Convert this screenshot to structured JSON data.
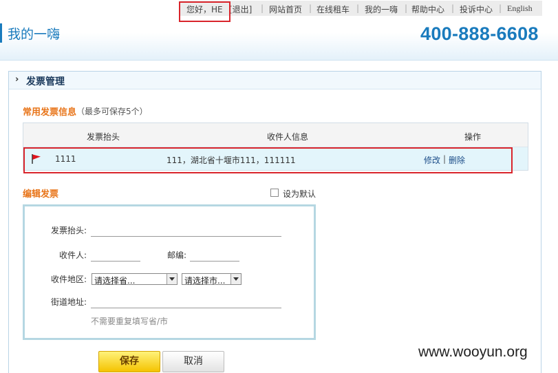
{
  "header": {
    "greeting": "您好，HE",
    "logout": "[退出]",
    "nav": [
      "网站首页",
      "在线租车",
      "我的一嗨",
      "帮助中心",
      "投诉中心",
      "English"
    ],
    "logo": "我的一嗨",
    "phone": "400-888-6608"
  },
  "panel": {
    "title": "发票管理"
  },
  "common_invoices": {
    "title": "常用发票信息",
    "note": "（最多可保存5个）",
    "columns": [
      "发票抬头",
      "收件人信息",
      "操作"
    ],
    "rows": [
      {
        "title": "1111",
        "recipient_info": "111，湖北省十堰市111，111111",
        "edit": "修改",
        "sep": "|",
        "delete": "删除"
      }
    ]
  },
  "edit_invoice": {
    "title": "编辑发票",
    "default_label": "设为默认",
    "fields": {
      "invoice_title_label": "发票抬头:",
      "recipient_label": "收件人:",
      "postcode_label": "邮编:",
      "region_label": "收件地区:",
      "province_placeholder": "请选择省...",
      "city_placeholder": "请选择市...",
      "street_label": "街道地址:",
      "street_hint": "不需要重复填写省/市"
    },
    "save": "保存",
    "cancel": "取消"
  },
  "watermark": "www.wooyun.org",
  "colors": {
    "accent_blue": "#1a7bbd",
    "section_orange": "#e8751a",
    "highlight_red": "#d9242b",
    "flag_red": "#e0141e"
  }
}
